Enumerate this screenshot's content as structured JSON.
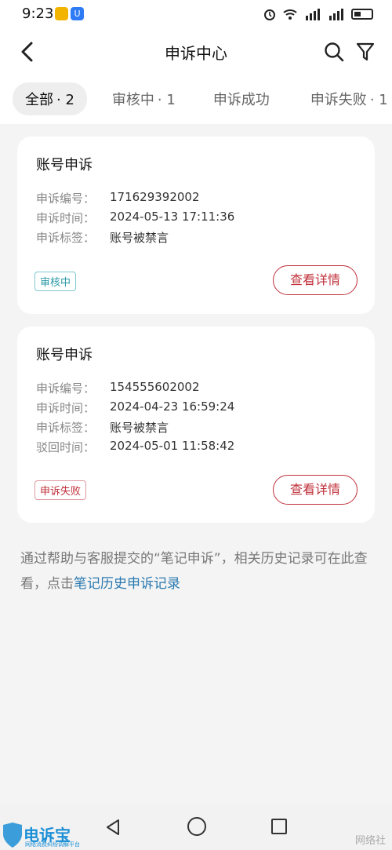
{
  "status": {
    "time": "9:23"
  },
  "header": {
    "title": "申诉中心"
  },
  "tabs": [
    {
      "label": "全部",
      "count": "· 2"
    },
    {
      "label": "审核中",
      "count": "· 1"
    },
    {
      "label": "申诉成功",
      "count": ""
    },
    {
      "label": "申诉失败",
      "count": "· 1"
    }
  ],
  "cards": [
    {
      "title": "账号申诉",
      "fields": [
        {
          "k": "申诉编号：",
          "v": "171629392002"
        },
        {
          "k": "申诉时间：",
          "v": "2024-05-13 17:11:36"
        },
        {
          "k": "申诉标签：",
          "v": "账号被禁言"
        }
      ],
      "badge": "审核中",
      "button": "查看详情"
    },
    {
      "title": "账号申诉",
      "fields": [
        {
          "k": "申诉编号：",
          "v": "154555602002"
        },
        {
          "k": "申诉时间：",
          "v": "2024-04-23 16:59:24"
        },
        {
          "k": "申诉标签：",
          "v": "账号被禁言"
        },
        {
          "k": "驳回时间：",
          "v": "2024-05-01 11:58:42"
        }
      ],
      "badge": "申诉失败",
      "button": "查看详情"
    }
  ],
  "note": {
    "text": "通过帮助与客服提交的“笔记申诉”，相关历史记录可在此查看，点击",
    "link": "笔记历史申诉记录"
  },
  "watermark": {
    "logo": "电诉宝",
    "logo_sub": "网络消费纠纷调解平台",
    "right": "网络社"
  },
  "colors": {
    "accent_red": "#c0303a",
    "review_teal": "#2a9aa6",
    "link_blue": "#2a79b0"
  }
}
